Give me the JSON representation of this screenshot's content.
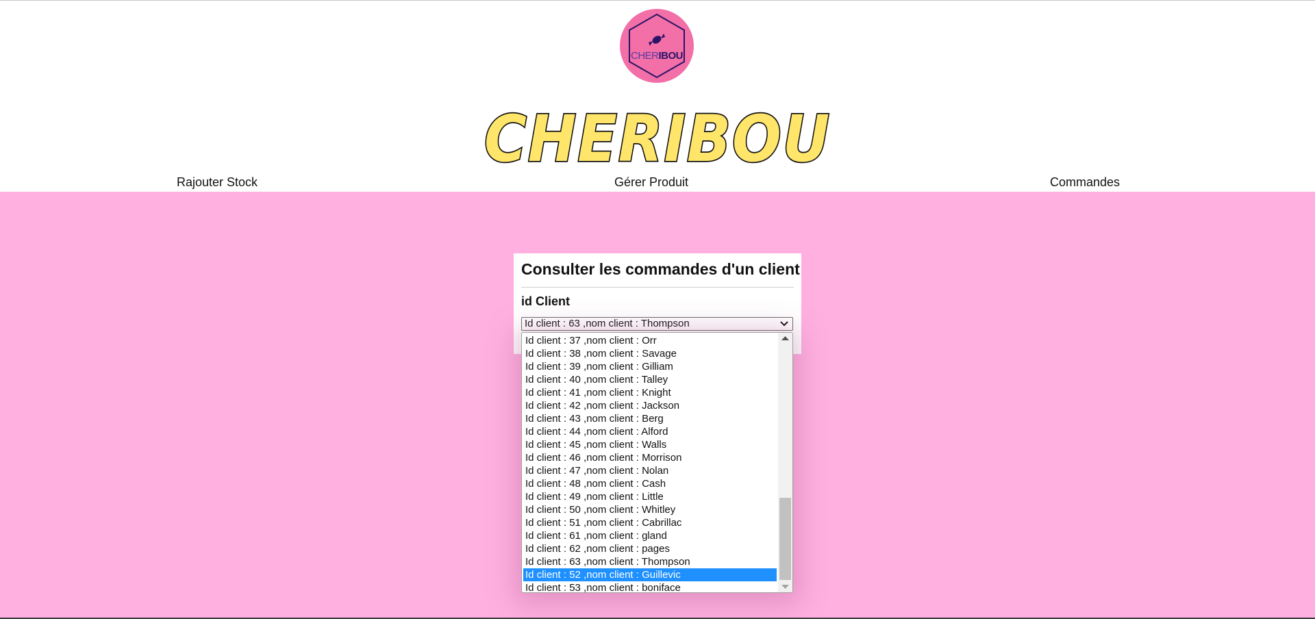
{
  "brand": {
    "logo_text_light": "CHER",
    "logo_text_bold": "IBOU",
    "wordmark": "CHERIBOU",
    "colors": {
      "logo_circle": "#f26fa8",
      "wordmark_fill": "#ffe66b",
      "wordmark_stroke": "#111111",
      "main_background": "#ffb0e0",
      "selected_option": "#1e90ff"
    },
    "icons": [
      "candy-icon",
      "hexagon-outline-icon"
    ]
  },
  "nav": {
    "items": [
      {
        "label": "Rajouter Stock"
      },
      {
        "label": "Gérer Produit"
      },
      {
        "label": "Commandes"
      }
    ]
  },
  "card": {
    "title": "Consulter les commandes d'un client",
    "field_label": "id Client",
    "select_value": "Id client : 63 ,nom client : Thompson"
  },
  "dropdown": {
    "options": [
      "Id client : 37 ,nom client : Orr",
      "Id client : 38 ,nom client : Savage",
      "Id client : 39 ,nom client : Gilliam",
      "Id client : 40 ,nom client : Talley",
      "Id client : 41 ,nom client : Knight",
      "Id client : 42 ,nom client : Jackson",
      "Id client : 43 ,nom client : Berg",
      "Id client : 44 ,nom client : Alford",
      "Id client : 45 ,nom client : Walls",
      "Id client : 46 ,nom client : Morrison",
      "Id client : 47 ,nom client : Nolan",
      "Id client : 48 ,nom client : Cash",
      "Id client : 49 ,nom client : Little",
      "Id client : 50 ,nom client : Whitley",
      "Id client : 51 ,nom client : Cabrillac",
      "Id client : 61 ,nom client : gland",
      "Id client : 62 ,nom client : pages",
      "Id client : 63 ,nom client : Thompson",
      "Id client : 52 ,nom client : Guillevic",
      "Id client : 53 ,nom client : boniface"
    ],
    "highlighted_option": "Id client : 52 ,nom client : Guillevic"
  }
}
